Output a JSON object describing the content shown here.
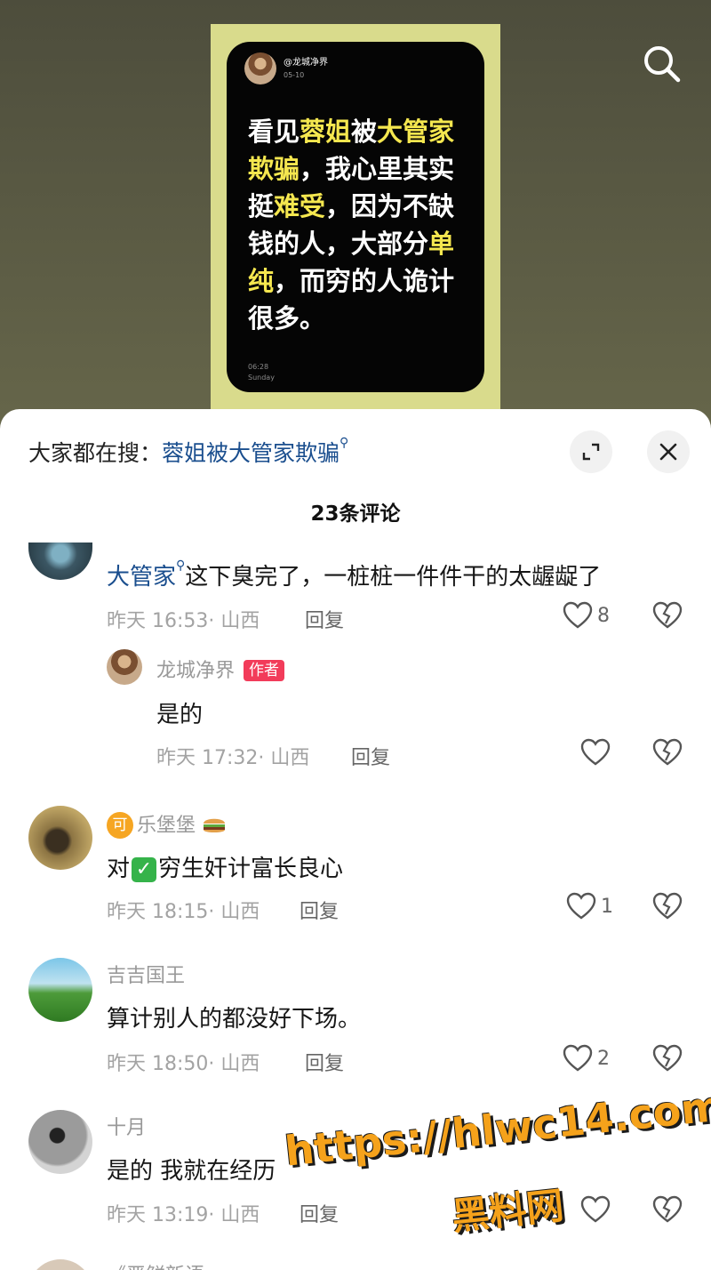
{
  "video": {
    "card": {
      "handle": "@龙城净界",
      "date": "05-10",
      "quote_parts": [
        {
          "text": "看见",
          "hl": false
        },
        {
          "text": "蓉姐",
          "hl": true
        },
        {
          "text": "被",
          "hl": false
        },
        {
          "text": "大管家",
          "hl": true
        },
        {
          "text": "欺骗",
          "hl": true
        },
        {
          "text": "，我心里其实挺",
          "hl": false
        },
        {
          "text": "难受",
          "hl": true
        },
        {
          "text": "，因为不缺钱的人，大部分",
          "hl": false
        },
        {
          "text": "单纯",
          "hl": true
        },
        {
          "text": "，而穷的人诡计很多。",
          "hl": false
        }
      ],
      "time": "06:28",
      "weekday": "Sunday"
    },
    "search_icon": "search-icon"
  },
  "sheet": {
    "search_prefix": "大家都在搜：",
    "search_term": "蓉姐被大管家欺骗",
    "search_glyph": "⚲",
    "expand_icon": "expand-icon",
    "close_icon": "close-icon",
    "comment_count": "23条评论",
    "reply_label": "回复"
  },
  "comments": {
    "c1": {
      "mention": "大管家",
      "glyph": "⚲",
      "text": "这下臭完了，一桩桩一件件干的太龌龊了",
      "meta": "昨天 16:53· 山西",
      "likes": "8"
    },
    "c1r": {
      "user": "龙城净界",
      "badge": "作者",
      "text": "是的",
      "meta": "昨天 17:32· 山西"
    },
    "c2": {
      "level": "可",
      "user": "乐堡堡",
      "text_before": "对",
      "check": "✓",
      "text_after": "穷生奸计富长良心",
      "meta": "昨天 18:15· 山西",
      "likes": "1"
    },
    "c3": {
      "user": "吉吉国王",
      "text": "算计别人的都没好下场。",
      "meta": "昨天 18:50· 山西",
      "likes": "2"
    },
    "c4": {
      "user": "十月",
      "text": "是的 我就在经历",
      "meta": "昨天 13:19· 山西"
    },
    "c5": {
      "user": "《严鲜新语"
    }
  },
  "watermark": {
    "url": "https://hlwc14.com",
    "name": "黑料网"
  },
  "colors": {
    "highlight": "#f5e74f",
    "link": "#1a4e8e",
    "author_badge": "#f23c5a",
    "watermark": "#f5a21b"
  }
}
